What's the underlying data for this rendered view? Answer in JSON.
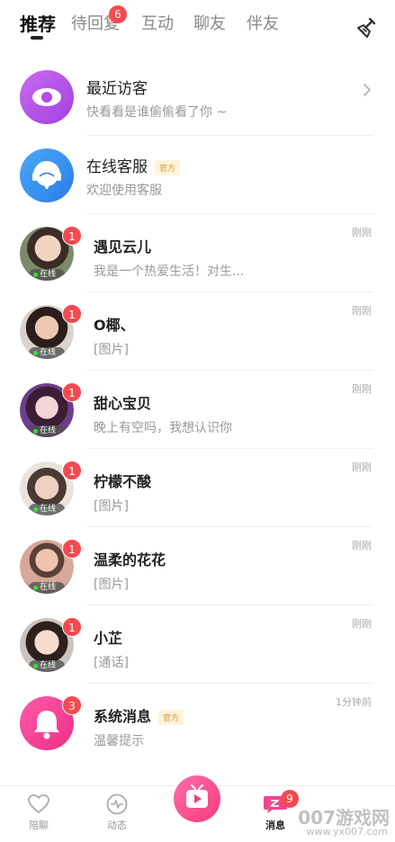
{
  "tabs": [
    {
      "label": "推荐"
    },
    {
      "label": "待回复",
      "badge": "6"
    },
    {
      "label": "互动"
    },
    {
      "label": "聊友"
    },
    {
      "label": "伴友"
    }
  ],
  "pinned": [
    {
      "name": "最近访客",
      "sub": "快看看是谁偷偷看了你 ~",
      "icon": "eye-icon",
      "color": "#b54ce6"
    },
    {
      "name": "在线客服",
      "tag": "官方",
      "sub": "欢迎使用客服",
      "icon": "customer-service-icon",
      "color": "#2f8ff4"
    }
  ],
  "online_label": "在线",
  "conversations": [
    {
      "name": "遇见云儿",
      "message": "我是一个热爱生活！对生...",
      "time": "刚刚",
      "unread": "1"
    },
    {
      "name": "O椰、",
      "message": "[图片]",
      "time": "刚刚",
      "unread": "1"
    },
    {
      "name": "甜心宝贝",
      "message": "晚上有空吗，我想认识你",
      "time": "刚刚",
      "unread": "1"
    },
    {
      "name": "柠檬不酸",
      "message": "[图片]",
      "time": "刚刚",
      "unread": "1"
    },
    {
      "name": "温柔的花花",
      "message": "[图片]",
      "time": "刚刚",
      "unread": "1"
    },
    {
      "name": "小芷",
      "message": "[通话]",
      "time": "刚刚",
      "unread": "1"
    }
  ],
  "system": {
    "name": "系统消息",
    "tag": "官方",
    "message": "温馨提示",
    "time": "1分钟前",
    "unread": "3",
    "color": "#f03c8f"
  },
  "nav": {
    "items": [
      {
        "label": "陪聊",
        "icon": "heart-icon"
      },
      {
        "label": "动态",
        "icon": "pulse-icon"
      },
      {
        "label": "消息",
        "icon": "message-icon",
        "badge": "9"
      }
    ],
    "center_icon": "tv-icon"
  },
  "watermark": {
    "main": "007游戏网",
    "sub": "www.yx007.com"
  }
}
